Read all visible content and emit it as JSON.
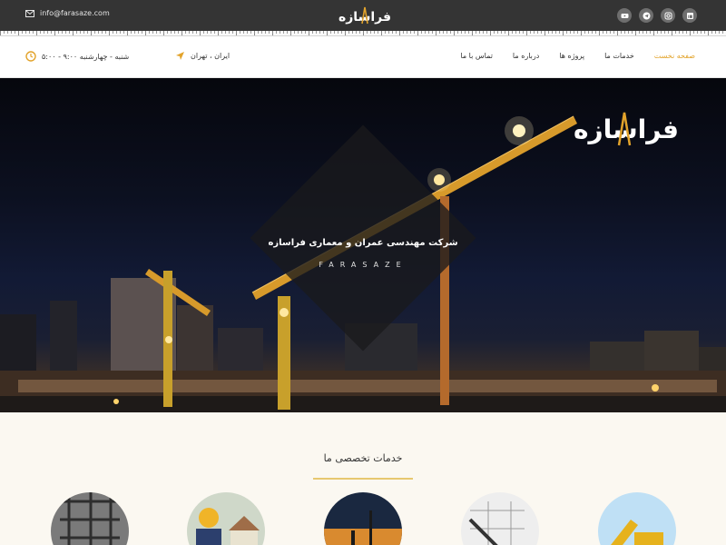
{
  "topbar": {
    "email": "info@farasaze.com",
    "logo_text": "فراسازه",
    "socials": [
      "youtube-icon",
      "telegram-icon",
      "instagram-icon",
      "linkedin-icon"
    ]
  },
  "nav": {
    "hours": "شنبه - چهارشنبه ۹:۰۰ - ۵:۰۰",
    "location": "ایران ، تهران",
    "menu": [
      "صفحه نخست",
      "خدمات ما",
      "پروژه ها",
      "درباره ما",
      "تماس با ما"
    ],
    "active_index": 0
  },
  "hero": {
    "brand": "فراسازه",
    "tagline": "شرکت مهندسی عمران و معماری فراسازه",
    "tagline_en": "FARASAZE"
  },
  "services": {
    "title": "خدمات تخصصی ما"
  },
  "colors": {
    "accent": "#e2a32b",
    "topbar": "#343434",
    "services_bg": "#fbf8f1"
  }
}
